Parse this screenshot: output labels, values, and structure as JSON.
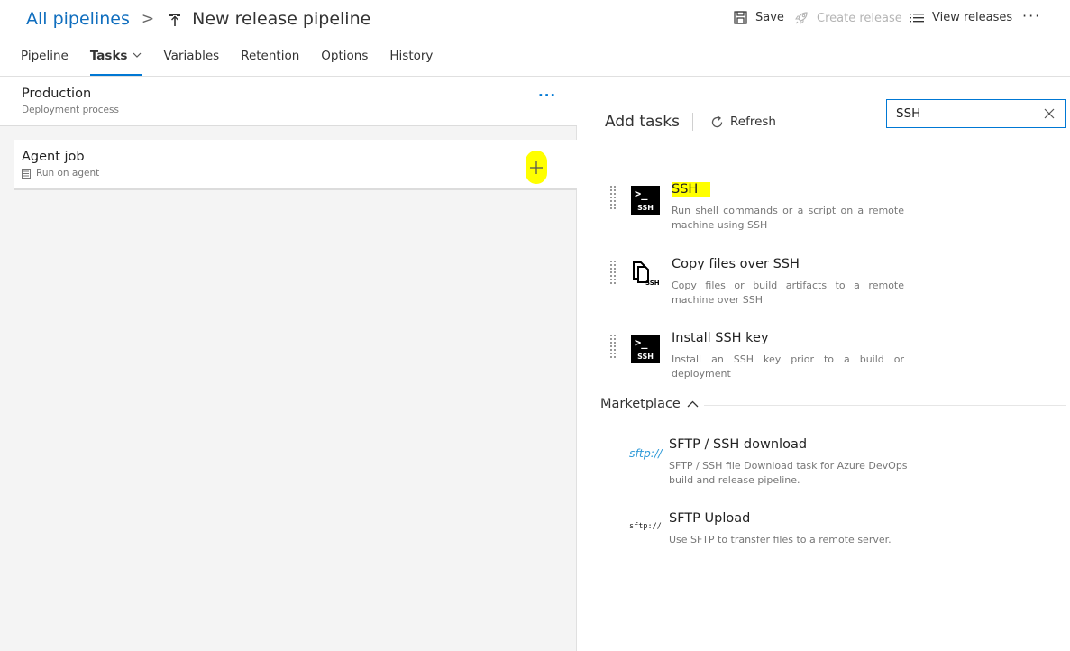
{
  "header": {
    "breadcrumb_root": "All pipelines",
    "breadcrumb_separator": ">",
    "title": "New release pipeline",
    "actions": {
      "save": "Save",
      "create_release": "Create release",
      "view_releases": "View releases",
      "more": "···"
    }
  },
  "tabs": [
    {
      "label": "Pipeline"
    },
    {
      "label": "Tasks",
      "active": true
    },
    {
      "label": "Variables"
    },
    {
      "label": "Retention"
    },
    {
      "label": "Options"
    },
    {
      "label": "History"
    }
  ],
  "stage": {
    "name": "Production",
    "subtitle": "Deployment process",
    "more": "···"
  },
  "job": {
    "name": "Agent job",
    "subtitle": "Run on agent"
  },
  "panel": {
    "title": "Add tasks",
    "refresh": "Refresh",
    "search_value": "SSH"
  },
  "tasks": [
    {
      "icon": "terminal-ssh-icon",
      "icon_label": "SSH",
      "prompt": ">_",
      "name": "SSH",
      "description": "Run shell commands or a script on a remote machine using SSH",
      "highlighted": true
    },
    {
      "icon": "copy-files-ssh-icon",
      "icon_label": "SSH",
      "name": "Copy files over SSH",
      "description": "Copy files or build artifacts to a remote machine over SSH"
    },
    {
      "icon": "terminal-ssh-icon",
      "icon_label": "SSH",
      "prompt": ">_",
      "name": "Install SSH key",
      "description": "Install an SSH key prior to a build or deployment"
    }
  ],
  "marketplace": {
    "label": "Marketplace",
    "items": [
      {
        "logo": "sftp://",
        "name": "SFTP / SSH download",
        "description": "SFTP / SSH file Download task for Azure DevOps build and release pipeline."
      },
      {
        "logo": "sftp://",
        "name": "SFTP Upload",
        "description": "Use SFTP to transfer files to a remote server."
      }
    ]
  },
  "colors": {
    "accent": "#0078d4",
    "highlight": "#ffff00",
    "link": "#106ebe",
    "disabled": "#b4b4b4"
  }
}
